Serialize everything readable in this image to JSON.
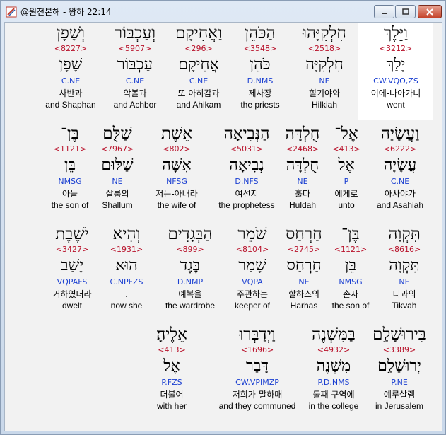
{
  "window": {
    "title": "@원전본해 - 왕하 22:14"
  },
  "rows": [
    {
      "words": [
        {
          "hebrew": "וַיֵּלֶךְ",
          "strong": "<3212>",
          "lemma": "יָלַךְ",
          "morph": "CW.VQO,ZS",
          "korean": "이에-나아가니",
          "english": "went",
          "selected": true
        },
        {
          "hebrew": "חִלְקִיָּהוּ",
          "strong": "<2518>",
          "lemma": "חִלְקִיָּה",
          "morph": "NE",
          "korean": "힐기야와",
          "english": "Hilkiah"
        },
        {
          "hebrew": "הַכֹּהֵן",
          "strong": "<3548>",
          "lemma": "כֹּהֵן",
          "morph": "D.NMS",
          "korean": "제사장",
          "english": "the priests"
        },
        {
          "hebrew": "וַאֲחִיקָם",
          "strong": "<296>",
          "lemma": "אֲחִיקָם",
          "morph": "C.NE",
          "korean": "또 아히감과",
          "english": "and Ahikam"
        },
        {
          "hebrew": "וְעַכְבּוֹר",
          "strong": "<5907>",
          "lemma": "עַכְבּוֹר",
          "morph": "C.NE",
          "korean": "악볼과",
          "english": "and Achbor"
        },
        {
          "hebrew": "וְשָׁפָן",
          "strong": "<8227>",
          "lemma": "שָׁפָן",
          "morph": "C.NE",
          "korean": "사반과",
          "english": "and Shaphan"
        }
      ]
    },
    {
      "words": [
        {
          "hebrew": "וַעֲשָׂיָה",
          "strong": "<6222>",
          "lemma": "עֲשָׂיָה",
          "morph": "C.NE",
          "korean": "아사야가",
          "english": "and Asahiah"
        },
        {
          "hebrew": "אֶל־",
          "strong": "<413>",
          "lemma": "אֶל",
          "morph": "P",
          "korean": "에게로",
          "english": "unto"
        },
        {
          "hebrew": "חֻלְדָּה",
          "strong": "<2468>",
          "lemma": "חֻלְדָּה",
          "morph": "NE",
          "korean": "훌다",
          "english": "Huldah"
        },
        {
          "hebrew": "הַנְּבִיאָה",
          "strong": "<5031>",
          "lemma": "נְבִיאָה",
          "morph": "D.NFS",
          "korean": "여선지",
          "english": "the prophetess"
        },
        {
          "hebrew": "אֵשֶׁת",
          "strong": "<802>",
          "lemma": "אִשָּׁה",
          "morph": "NFSG",
          "korean": "저는-아내라",
          "english": "the wife of"
        },
        {
          "hebrew": "שַׁלֻּם",
          "strong": "<7967>",
          "lemma": "שַׁלּוּם",
          "morph": "NE",
          "korean": "살룸의",
          "english": "Shallum"
        },
        {
          "hebrew": "בֶּן־",
          "strong": "<1121>",
          "lemma": "בֵּן",
          "morph": "NMSG",
          "korean": "아들",
          "english": "the son of"
        }
      ]
    },
    {
      "words": [
        {
          "hebrew": "תִּקְוָה",
          "strong": "<8616>",
          "lemma": "תִּקְוָה",
          "morph": "NE",
          "korean": "디과의",
          "english": "Tikvah"
        },
        {
          "hebrew": "בֶּן־",
          "strong": "<1121>",
          "lemma": "בֵּן",
          "morph": "NMSG",
          "korean": "손자",
          "english": "the son of"
        },
        {
          "hebrew": "חַרְחַס",
          "strong": "<2745>",
          "lemma": "חַרְחַס",
          "morph": "NE",
          "korean": "할하스의",
          "english": "Harhas"
        },
        {
          "hebrew": "שֹׁמֵר",
          "strong": "<8104>",
          "lemma": "שָׁמַר",
          "morph": "VQPA",
          "korean": "주관하는",
          "english": "keeper of"
        },
        {
          "hebrew": "הַבְּגָדִים",
          "strong": "<899>",
          "lemma": "בֶּגֶד",
          "morph": "D.NMP",
          "korean": "예복을",
          "english": "the wardrobe"
        },
        {
          "hebrew": "וְהִיא",
          "strong": "<1931>",
          "lemma": "הוּא",
          "morph": "C.NPFZS",
          "korean": ".",
          "english": "now she"
        },
        {
          "hebrew": "יֹשֶׁבֶת",
          "strong": "<3427>",
          "lemma": "יָשַׁב",
          "morph": "VQPAFS",
          "korean": "거하였더라",
          "english": "dwelt"
        }
      ]
    },
    {
      "words": [
        {
          "hebrew": "בִּירוּשָׁלִַם",
          "strong": "<3389>",
          "lemma": "יְרוּשָׁלִַם",
          "morph": "P.NE",
          "korean": "예루살렘",
          "english": "in Jerusalem"
        },
        {
          "hebrew": "בַּמִּשְׁנֶה",
          "strong": "<4932>",
          "lemma": "מִשְׁנֶה",
          "morph": "P.D.NMS",
          "korean": "둘째 구역에",
          "english": "in the college"
        },
        {
          "hebrew": "וַיְדַבְּרוּ",
          "strong": "<1696>",
          "lemma": "דָּבַר",
          "morph": "CW.VPIMZP",
          "korean": "저희가-말하매",
          "english": "and they communed"
        },
        {
          "hebrew": "אֵלֶיהָ׃",
          "strong": "<413>",
          "lemma": "אֶל",
          "morph": "P.FZS",
          "korean": "더불어",
          "english": "with her"
        }
      ]
    }
  ]
}
